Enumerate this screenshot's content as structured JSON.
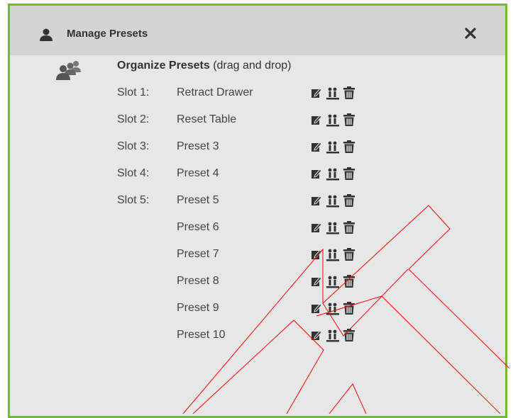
{
  "dialog": {
    "title": "Manage Presets",
    "close_icon": "close-icon",
    "header_icon": "user-icon"
  },
  "organize": {
    "icon": "users-icon",
    "title_bold": "Organize Presets",
    "title_hint": "(drag and drop)"
  },
  "presets": [
    {
      "slot": "Slot 1:",
      "name": "Retract Drawer"
    },
    {
      "slot": "Slot 2:",
      "name": "Reset Table"
    },
    {
      "slot": "Slot 3:",
      "name": "Preset 3"
    },
    {
      "slot": "Slot 4:",
      "name": "Preset 4"
    },
    {
      "slot": "Slot 5:",
      "name": "Preset 5"
    },
    {
      "slot": "",
      "name": "Preset 6"
    },
    {
      "slot": "",
      "name": "Preset 7"
    },
    {
      "slot": "",
      "name": "Preset 8"
    },
    {
      "slot": "",
      "name": "Preset 9"
    },
    {
      "slot": "",
      "name": "Preset 10"
    }
  ],
  "row_actions": [
    "edit-icon",
    "move-icon",
    "trash-icon"
  ],
  "colors": {
    "frame_border": "#6fbf2a",
    "header_bg": "#d4d4d4",
    "body_bg": "#e7e7e7",
    "text": "#333333",
    "overlay_stroke": "#ff0000"
  }
}
